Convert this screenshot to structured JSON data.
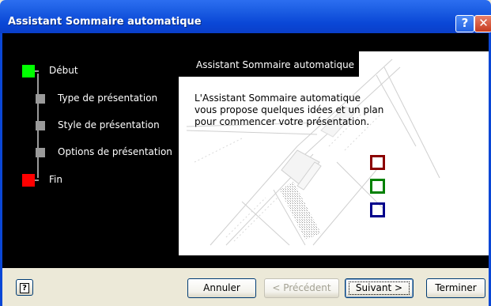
{
  "window": {
    "title": "Assistant Sommaire automatique",
    "help_glyph": "?",
    "close_glyph": "✕"
  },
  "steps": [
    {
      "label": "Début",
      "color": "#00ff00",
      "current": true
    },
    {
      "label": "Type de présentation",
      "color": "#9a9a9a"
    },
    {
      "label": "Style de présentation",
      "color": "#9a9a9a"
    },
    {
      "label": "Options de présentation",
      "color": "#9a9a9a"
    },
    {
      "label": "Fin",
      "color": "#ff0000"
    }
  ],
  "content": {
    "header": "Assistant Sommaire automatique",
    "description": "L'Assistant Sommaire automatique vous propose quelques idées et un plan pour commencer votre présentation."
  },
  "marks": [
    {
      "color": "#8b0000",
      "name": "red-square-icon"
    },
    {
      "color": "#008000",
      "name": "green-square-icon"
    },
    {
      "color": "#00008b",
      "name": "blue-square-icon"
    }
  ],
  "buttons": {
    "help_glyph": "?",
    "cancel": "Annuler",
    "previous": "< Précédent",
    "next": "Suivant >",
    "finish": "Terminer"
  }
}
